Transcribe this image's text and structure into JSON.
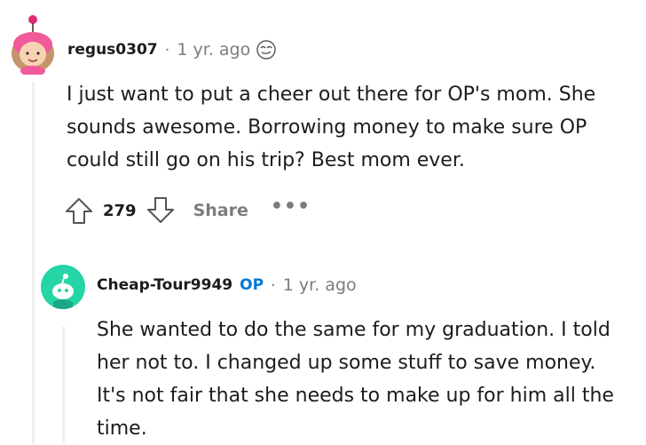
{
  "comments": [
    {
      "author": "regus0307",
      "separator": "·",
      "time": "1 yr. ago",
      "award_icon": "emoji-award-icon",
      "body_lines": [
        "I just want to put a cheer out there for OP's mom. She",
        "sounds awesome. Borrowing money to make sure OP",
        "could still go on his trip? Best mom ever."
      ],
      "votes": "279",
      "share_label": "Share",
      "more_label": "•••"
    },
    {
      "author": "Cheap-Tour9949",
      "op_badge": "OP",
      "separator": "·",
      "time": "1 yr. ago",
      "body_lines": [
        "She wanted to do the same for my graduation. I told",
        "her not to. I changed up some stuff to save money.",
        "It's not fair that she needs to make up for him all the",
        "time."
      ]
    }
  ],
  "colors": {
    "op_badge": "#0079d3",
    "meta_gray": "#7c7c7c",
    "avatar_teal": "#24d5a5"
  }
}
